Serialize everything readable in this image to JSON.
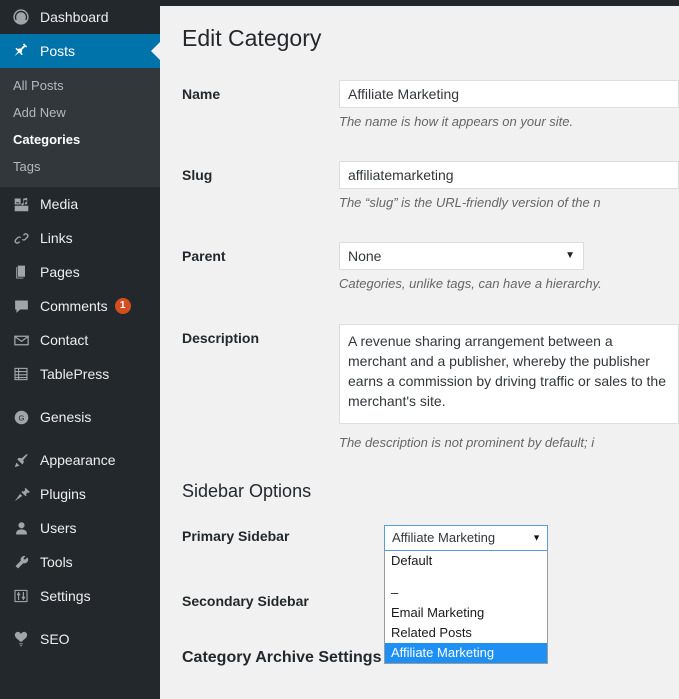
{
  "sidebar": {
    "items": [
      {
        "label": "Dashboard",
        "icon": "dashboard-icon",
        "state": "normal"
      },
      {
        "label": "Posts",
        "icon": "pin-icon",
        "state": "active"
      },
      {
        "label": "Media",
        "icon": "media-icon",
        "state": "normal"
      },
      {
        "label": "Links",
        "icon": "link-icon",
        "state": "normal"
      },
      {
        "label": "Pages",
        "icon": "pages-icon",
        "state": "normal"
      },
      {
        "label": "Comments",
        "icon": "comment-icon",
        "state": "normal",
        "badge": "1"
      },
      {
        "label": "Contact",
        "icon": "envelope-icon",
        "state": "normal"
      },
      {
        "label": "TablePress",
        "icon": "table-icon",
        "state": "normal"
      },
      {
        "label": "Genesis",
        "icon": "genesis-g-icon",
        "state": "normal"
      },
      {
        "label": "Appearance",
        "icon": "paintbrush-icon",
        "state": "normal"
      },
      {
        "label": "Plugins",
        "icon": "plug-icon",
        "state": "normal"
      },
      {
        "label": "Users",
        "icon": "user-icon",
        "state": "normal"
      },
      {
        "label": "Tools",
        "icon": "wrench-icon",
        "state": "normal"
      },
      {
        "label": "Settings",
        "icon": "sliders-icon",
        "state": "normal"
      },
      {
        "label": "SEO",
        "icon": "seo-icon",
        "state": "normal"
      }
    ],
    "submenu": [
      {
        "label": "All Posts",
        "current": false
      },
      {
        "label": "Add New",
        "current": false
      },
      {
        "label": "Categories",
        "current": true
      },
      {
        "label": "Tags",
        "current": false
      }
    ],
    "badge_color": "#d54e21",
    "active_color": "#0073aa",
    "background_color": "#23282d",
    "submenu_background_color": "#32373c"
  },
  "main": {
    "page_title": "Edit Category",
    "fields": {
      "name": {
        "label": "Name",
        "value": "Affiliate Marketing",
        "description": "The name is how it appears on your site."
      },
      "slug": {
        "label": "Slug",
        "value": "affiliatemarketing",
        "description": "The “slug” is the URL-friendly version of the n"
      },
      "parent": {
        "label": "Parent",
        "value": "None",
        "description": "Categories, unlike tags, can have a hierarchy."
      },
      "description": {
        "label": "Description",
        "value": "A revenue sharing arrangement between a merchant and a publisher, whereby the publisher earns a commission by driving traffic or sales to the merchant's site.",
        "description": "The description is not prominent by default; i"
      }
    },
    "sidebar_options": {
      "heading": "Sidebar Options",
      "primary": {
        "label": "Primary Sidebar",
        "selected": "Affiliate Marketing",
        "options": [
          {
            "label": "Default",
            "selected": false,
            "spacer_after": true
          },
          {
            "label": "–",
            "selected": false
          },
          {
            "label": "Email Marketing",
            "selected": false
          },
          {
            "label": "Related Posts",
            "selected": false
          },
          {
            "label": "Affiliate Marketing",
            "selected": true
          }
        ],
        "highlight_color": "#1e90f4",
        "focus_border_color": "#5b9dd9"
      },
      "secondary": {
        "label": "Secondary Sidebar"
      }
    },
    "archive_settings": {
      "heading": "Category Archive Settings"
    },
    "caret_glyph": "▼"
  }
}
